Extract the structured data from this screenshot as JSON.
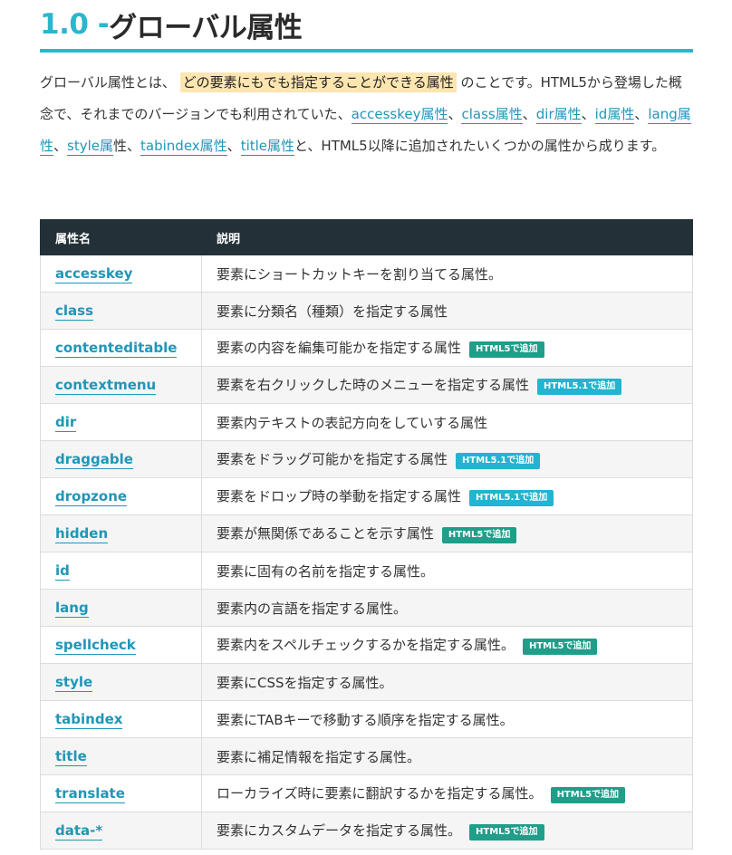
{
  "heading": {
    "number": "1.0 - ",
    "title": "グローバル属性"
  },
  "intro": {
    "t1": "グローバル属性とは、",
    "highlight": "どの要素にもでも指定することができる属性",
    "t2": "のことです。HTML5から登場した概念で、それまでのバージョンでも利用されていた、",
    "link_accesskey": "accesskey属性",
    "sep1": "、",
    "link_class": "class属性",
    "sep2": "、",
    "link_dir": "dir属性",
    "sep3": "、",
    "link_id": "id属性",
    "sep4": "、",
    "link_lang": "lang属性",
    "sep5": "、",
    "link_style": "style属",
    "style_tail": "性、",
    "link_tabindex": "tabindex属性",
    "sep6": "、",
    "link_title": "title属性",
    "t3": "と、HTML5以降に追加されたいくつかの属性から成ります。"
  },
  "table": {
    "headers": [
      "属性名",
      "説明"
    ],
    "rows": [
      {
        "name": "accesskey",
        "desc": "要素にショートカットキーを割り当てる属性。",
        "badge": ""
      },
      {
        "name": "class",
        "desc": "要素に分類名（種類）を指定する属性",
        "badge": ""
      },
      {
        "name": "contenteditable",
        "desc": "要素の内容を編集可能かを指定する属性",
        "badge": "HTML5で追加"
      },
      {
        "name": "contextmenu",
        "desc": "要素を右クリックした時のメニューを指定する属性",
        "badge": "HTML5.1で追加"
      },
      {
        "name": "dir",
        "desc": "要素内テキストの表記方向をしていする属性",
        "badge": ""
      },
      {
        "name": "draggable",
        "desc": "要素をドラッグ可能かを指定する属性",
        "badge": "HTML5.1で追加"
      },
      {
        "name": "dropzone",
        "desc": "要素をドロップ時の挙動を指定する属性",
        "badge": "HTML5.1で追加"
      },
      {
        "name": "hidden",
        "desc": "要素が無関係であることを示す属性",
        "badge": "HTML5で追加"
      },
      {
        "name": "id",
        "desc": "要素に固有の名前を指定する属性。",
        "badge": ""
      },
      {
        "name": "lang",
        "desc": "要素内の言語を指定する属性。",
        "badge": ""
      },
      {
        "name": "spellcheck",
        "desc": "要素内をスペルチェックするかを指定する属性。",
        "badge": "HTML5で追加"
      },
      {
        "name": "style",
        "desc": "要素にCSSを指定する属性。",
        "badge": ""
      },
      {
        "name": "tabindex",
        "desc": "要素にTABキーで移動する順序を指定する属性。",
        "badge": ""
      },
      {
        "name": "title",
        "desc": "要素に補足情報を指定する属性。",
        "badge": ""
      },
      {
        "name": "translate",
        "desc": "ローカライズ時に要素に翻訳するかを指定する属性。",
        "badge": "HTML5で追加"
      },
      {
        "name": "data-*",
        "desc": "要素にカスタムデータを指定する属性。",
        "badge": "HTML5で追加"
      }
    ]
  },
  "colors": {
    "accent": "#2bb6cd",
    "link": "#2096b8",
    "highlight": "#fde5b0",
    "table_header": "#243038",
    "badge_html5": "#1f9e8a",
    "badge_html51": "#22b4d0"
  }
}
